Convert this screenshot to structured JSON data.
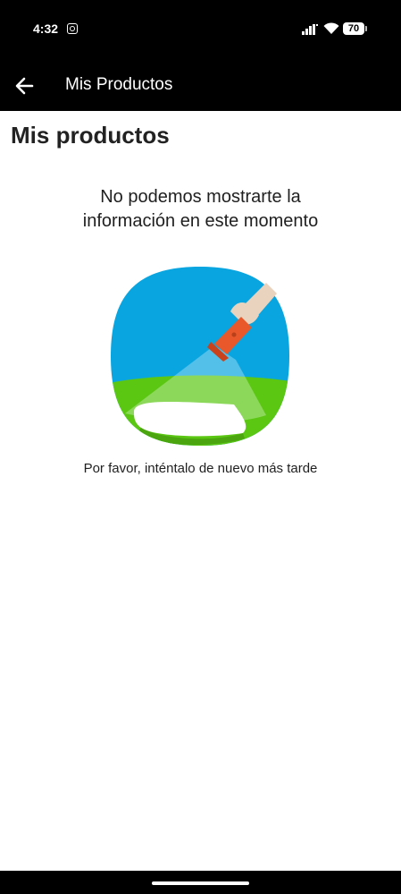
{
  "status_bar": {
    "time": "4:32",
    "battery": "70",
    "icons": [
      "instagram-icon",
      "signal-icon",
      "wifi-icon",
      "battery-icon"
    ]
  },
  "app_bar": {
    "back_icon": "arrow-left-icon",
    "title": "Mis Productos"
  },
  "main": {
    "page_title": "Mis productos",
    "message_line1": "No podemos mostrarte la",
    "message_line2": "información en este momento",
    "illustration": "flashlight-illustration",
    "hint": "Por favor, inténtalo de nuevo más tarde"
  },
  "colors": {
    "bar_background": "#000000",
    "sky_blue": "#09A5E0",
    "grass_green": "#5BC713",
    "flashlight_orange": "#E8582A",
    "hand_skin": "#E9D3BE"
  }
}
